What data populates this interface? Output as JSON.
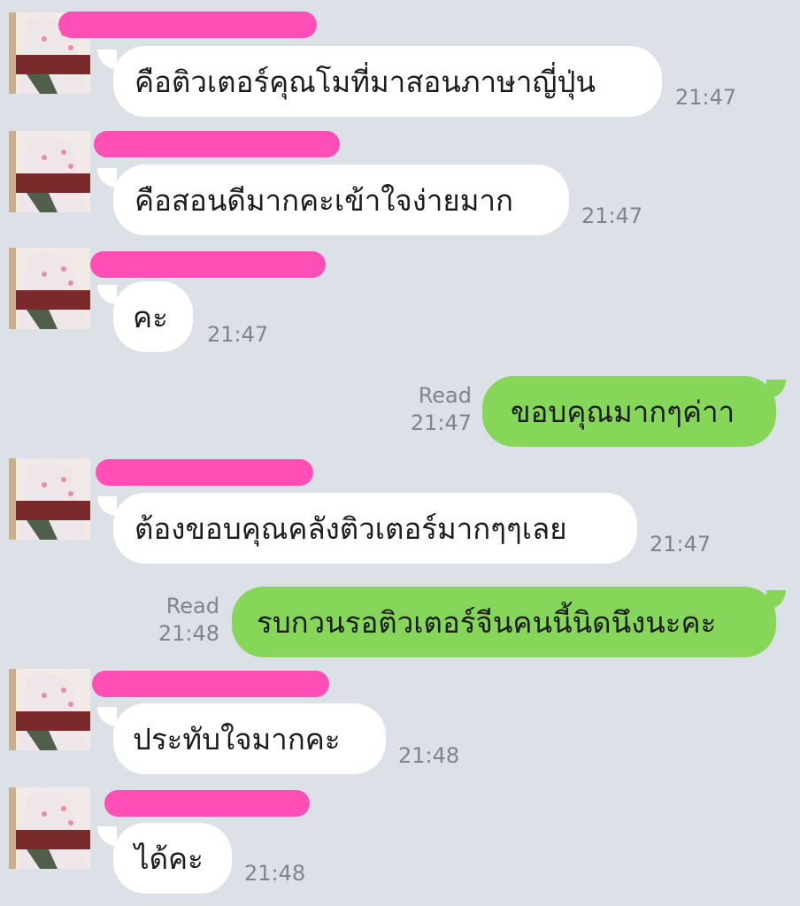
{
  "conversation": {
    "messages": [
      {
        "direction": "incoming",
        "text": "คือติวเตอร์คุณโมที่มาสอนภาษาญี่ปุ่น",
        "time": "21:47"
      },
      {
        "direction": "incoming",
        "text": "คือสอนดีมากคะเข้าใจง่ายมาก",
        "time": "21:47"
      },
      {
        "direction": "incoming",
        "text": "คะ",
        "time": "21:47"
      },
      {
        "direction": "outgoing",
        "text": "ขอบคุณมากๆค่าา",
        "time": "21:47",
        "status": "Read"
      },
      {
        "direction": "incoming",
        "text": "ต้องขอบคุณคลังติวเตอร์มากๆๆเลย",
        "time": "21:47"
      },
      {
        "direction": "outgoing",
        "text": "รบกวนรอติวเตอร์จีนคนนี้นิดนึงนะคะ",
        "time": "21:48",
        "status": "Read"
      },
      {
        "direction": "incoming",
        "text": "ประทับใจมากคะ",
        "time": "21:48"
      },
      {
        "direction": "incoming",
        "text": "ได้คะ",
        "time": "21:48"
      }
    ]
  },
  "colors": {
    "background": "#dce0e7",
    "incoming_bubble": "#ffffff",
    "outgoing_bubble": "#86d65a",
    "name_redaction": "#ff4fb6",
    "timestamp": "#7d8593"
  },
  "icons": {
    "avatar": "contact-photo-avatar"
  }
}
